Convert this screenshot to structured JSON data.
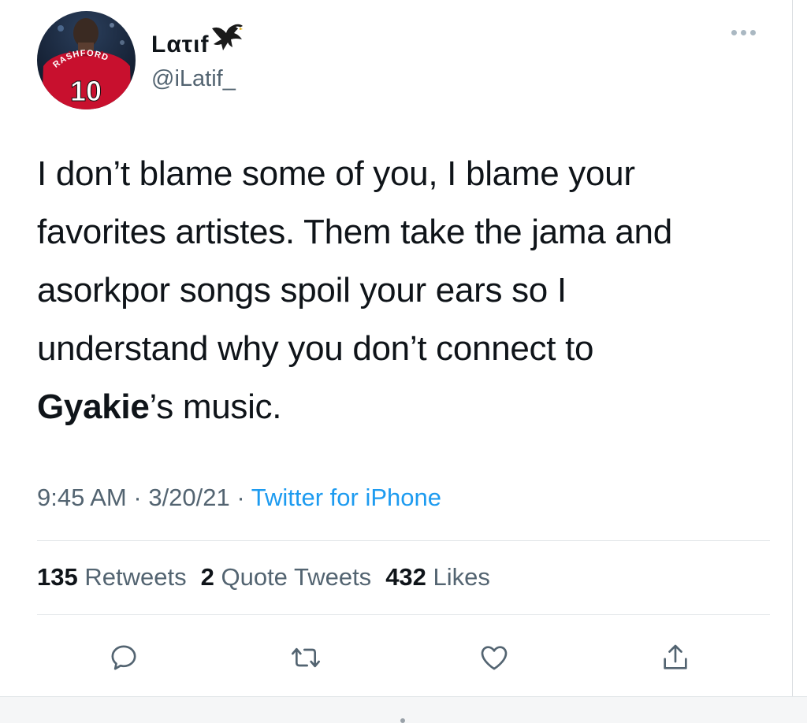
{
  "tweet": {
    "author": {
      "display_name": "Lατιf",
      "handle": "@iLatif_",
      "avatar": {
        "jersey_name": "RASHFORD",
        "jersey_number": "10"
      }
    },
    "text_lines": [
      "I don’t blame some of you, I blame your",
      "favorites artistes. Them take the jama and",
      "asorkpor songs spoil your ears so I",
      "understand why you don’t connect to"
    ],
    "text_last_bold": "Gyakie",
    "text_last_rest": "’s music.",
    "time": "9:45 AM",
    "separator": "·",
    "date": "3/20/21",
    "source": "Twitter for iPhone",
    "stats": {
      "retweets_count": "135",
      "retweets_label": "Retweets",
      "quotes_count": "2",
      "quotes_label": "Quote Tweets",
      "likes_count": "432",
      "likes_label": "Likes"
    }
  },
  "icons": {
    "more": "more-options-icon",
    "reply": "reply-icon",
    "retweet": "retweet-icon",
    "like": "like-icon",
    "share": "share-icon",
    "emoji": "eagle-icon"
  },
  "colors": {
    "text": "#0f1419",
    "secondary": "#536471",
    "link": "#1d9bf0",
    "icon": "#536471",
    "divider": "#e1e5e8"
  }
}
